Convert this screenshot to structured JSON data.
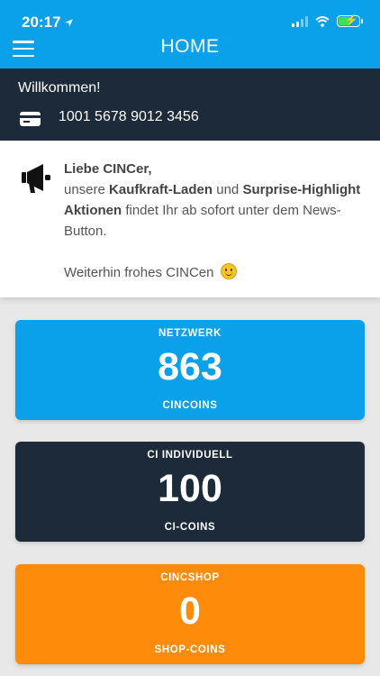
{
  "status_bar": {
    "time": "20:17"
  },
  "header": {
    "title": "HOME"
  },
  "user": {
    "welcome": "Willkommen!",
    "card_number": "1001 5678 9012 3456"
  },
  "notice": {
    "greeting": "Liebe CINCer,",
    "line_prefix": "unsere",
    "highlight_1": "Kaufkraft-Laden",
    "connector": "und",
    "highlight_2": "Surprise-Highlight Aktionen",
    "line_suffix": "findet Ihr ab sofort unter dem News-Button.",
    "closing": "Weiterhin frohes CINCen"
  },
  "tiles": [
    {
      "label": "NETZWERK",
      "value": "863",
      "unit": "CINCOINS",
      "color": "#0aa1ea"
    },
    {
      "label": "CI INDIVIDUELL",
      "value": "100",
      "unit": "CI-COINS",
      "color": "#1c2a3a"
    },
    {
      "label": "CINCSHOP",
      "value": "0",
      "unit": "SHOP-COINS",
      "color": "#ff8b0a"
    }
  ],
  "colors": {
    "accent": "#0aa1ea",
    "dark": "#1c2a3a",
    "orange": "#ff8b0a"
  },
  "icons": [
    "location-arrow-icon",
    "signal-icon",
    "wifi-icon",
    "battery-icon",
    "menu-icon",
    "credit-card-icon",
    "megaphone-icon",
    "smiley-icon"
  ]
}
